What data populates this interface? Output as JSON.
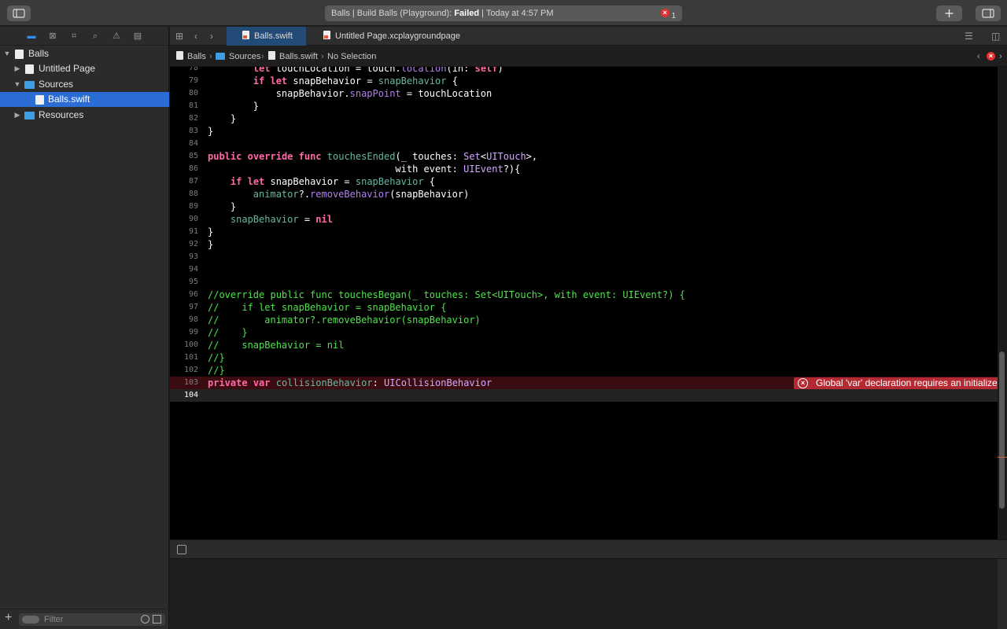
{
  "activity": {
    "prefix": "Balls | Build Balls (Playground): ",
    "status": "Failed",
    "suffix": " | Today at 4:57 PM",
    "error_count": "1"
  },
  "navigator": {
    "tree": [
      {
        "label": "Balls",
        "depth": 0,
        "icon": "project-icon",
        "expanded": true,
        "selected": false
      },
      {
        "label": "Untitled Page",
        "depth": 1,
        "icon": "playground-page-icon",
        "expanded": false,
        "selected": false
      },
      {
        "label": "Sources",
        "depth": 1,
        "icon": "folder-icon",
        "expanded": true,
        "selected": false
      },
      {
        "label": "Balls.swift",
        "depth": 2,
        "icon": "swift-file-icon",
        "expanded": null,
        "selected": true
      },
      {
        "label": "Resources",
        "depth": 1,
        "icon": "folder-icon",
        "expanded": false,
        "selected": false
      }
    ],
    "filter_placeholder": "Filter"
  },
  "tabs": [
    {
      "label": "Balls.swift",
      "active": true
    },
    {
      "label": "Untitled Page.xcplaygroundpage",
      "active": false
    }
  ],
  "jumpbar": {
    "items": [
      "Balls",
      "Sources",
      "Balls.swift",
      "No Selection"
    ]
  },
  "editor": {
    "lines": [
      {
        "n": "78",
        "tokens": [
          [
            "",
            "        "
          ],
          [
            "kw",
            "let"
          ],
          [
            "",
            " touchLocation = touch."
          ],
          [
            "pr",
            "location"
          ],
          [
            "",
            "("
          ],
          [
            "",
            "in"
          ],
          [
            "",
            ": "
          ],
          [
            "kw",
            "self"
          ],
          [
            "",
            ")"
          ]
        ]
      },
      {
        "n": "79",
        "tokens": [
          [
            "",
            "        "
          ],
          [
            "kw",
            "if"
          ],
          [
            "",
            " "
          ],
          [
            "kw",
            "let"
          ],
          [
            "",
            " snapBehavior = "
          ],
          [
            "fn",
            "snapBehavior"
          ],
          [
            "",
            " {"
          ]
        ]
      },
      {
        "n": "80",
        "tokens": [
          [
            "",
            "            snapBehavior."
          ],
          [
            "pr",
            "snapPoint"
          ],
          [
            "",
            " = touchLocation"
          ]
        ]
      },
      {
        "n": "81",
        "tokens": [
          [
            "",
            "        }"
          ]
        ]
      },
      {
        "n": "82",
        "tokens": [
          [
            "",
            "    }"
          ]
        ]
      },
      {
        "n": "83",
        "tokens": [
          [
            "",
            "}"
          ]
        ]
      },
      {
        "n": "84",
        "tokens": []
      },
      {
        "n": "85",
        "tokens": [
          [
            "kw",
            "public"
          ],
          [
            "",
            " "
          ],
          [
            "kw",
            "override"
          ],
          [
            "",
            " "
          ],
          [
            "kw",
            "func"
          ],
          [
            "",
            " "
          ],
          [
            "fn",
            "touchesEnded"
          ],
          [
            "",
            "(_ touches: "
          ],
          [
            "ty",
            "Set"
          ],
          [
            "",
            "<"
          ],
          [
            "ty",
            "UITouch"
          ],
          [
            "",
            ">,"
          ]
        ]
      },
      {
        "n": "86",
        "tokens": [
          [
            "",
            "                                 with event: "
          ],
          [
            "ty",
            "UIEvent"
          ],
          [
            "",
            "?){"
          ]
        ]
      },
      {
        "n": "87",
        "tokens": [
          [
            "",
            "    "
          ],
          [
            "kw",
            "if"
          ],
          [
            "",
            " "
          ],
          [
            "kw",
            "let"
          ],
          [
            "",
            " snapBehavior = "
          ],
          [
            "fn",
            "snapBehavior"
          ],
          [
            "",
            " {"
          ]
        ]
      },
      {
        "n": "88",
        "tokens": [
          [
            "",
            "        "
          ],
          [
            "fn",
            "animator"
          ],
          [
            "",
            "?."
          ],
          [
            "pr",
            "removeBehavior"
          ],
          [
            "",
            "(snapBehavior)"
          ]
        ]
      },
      {
        "n": "89",
        "tokens": [
          [
            "",
            "    }"
          ]
        ]
      },
      {
        "n": "90",
        "tokens": [
          [
            "",
            "    "
          ],
          [
            "fn",
            "snapBehavior"
          ],
          [
            "",
            " = "
          ],
          [
            "nl",
            "nil"
          ]
        ]
      },
      {
        "n": "91",
        "tokens": [
          [
            "",
            "}"
          ]
        ]
      },
      {
        "n": "92",
        "tokens": [
          [
            "",
            "}"
          ]
        ]
      },
      {
        "n": "93",
        "tokens": []
      },
      {
        "n": "94",
        "tokens": []
      },
      {
        "n": "95",
        "tokens": []
      },
      {
        "n": "96",
        "tokens": [
          [
            "cm",
            "//override public func touchesBegan(_ touches: Set<UITouch>, with event: UIEvent?) {"
          ]
        ]
      },
      {
        "n": "97",
        "tokens": [
          [
            "cm",
            "//    if let snapBehavior = snapBehavior {"
          ]
        ]
      },
      {
        "n": "98",
        "tokens": [
          [
            "cm",
            "//        animator?.removeBehavior(snapBehavior)"
          ]
        ]
      },
      {
        "n": "99",
        "tokens": [
          [
            "cm",
            "//    }"
          ]
        ]
      },
      {
        "n": "100",
        "tokens": [
          [
            "cm",
            "//    snapBehavior = nil"
          ]
        ]
      },
      {
        "n": "101",
        "tokens": [
          [
            "cm",
            "//}"
          ]
        ]
      },
      {
        "n": "102",
        "tokens": [
          [
            "cm",
            "//}"
          ]
        ]
      },
      {
        "n": "103",
        "tokens": [
          [
            "kw",
            "private"
          ],
          [
            "",
            " "
          ],
          [
            "kw",
            "var"
          ],
          [
            "",
            " "
          ],
          [
            "fn",
            "collisionBehavior"
          ],
          [
            "",
            ": "
          ],
          [
            "ty",
            "UICollisionBehavior"
          ]
        ],
        "error": true
      },
      {
        "n": "104",
        "tokens": [],
        "current": true
      }
    ],
    "error_message": "Global 'var' declaration requires an initializer expression or getter/setter specifier"
  },
  "colors": {
    "accent": "#2c6dd5",
    "error": "#b42a33",
    "keyword": "#ff6aa7",
    "comment": "#4ee34b"
  }
}
